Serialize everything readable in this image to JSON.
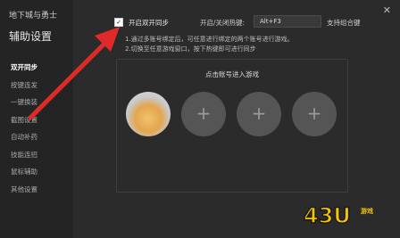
{
  "app": {
    "title": "地下城与勇士",
    "panel_title": "辅助设置"
  },
  "sidebar": {
    "items": [
      {
        "label": "双开同步",
        "active": true
      },
      {
        "label": "按键连发"
      },
      {
        "label": "一键换装"
      },
      {
        "label": "截图设置"
      },
      {
        "label": "自动补药"
      },
      {
        "label": "技能连招"
      },
      {
        "label": "鼠标辅助"
      },
      {
        "label": "其他设置"
      }
    ]
  },
  "settings": {
    "sync_label": "开启双开同步",
    "hotkey_label": "开启/关闭热键:",
    "hotkey_value": "Alt+F3",
    "combo_support": "支持组合键",
    "desc_line1": "1.通过多账号绑定后，可任意进行绑定的两个账号进行游戏。",
    "desc_line2": "2.切换至任意游戏窗口，按下热键即可进行同步"
  },
  "accounts": {
    "title": "点击账号进入游戏",
    "plus": "+"
  },
  "watermark": {
    "number": "43U",
    "sub": "游戏"
  },
  "colors": {
    "arrow": "#e02a2a",
    "watermark": "#f5c400"
  }
}
